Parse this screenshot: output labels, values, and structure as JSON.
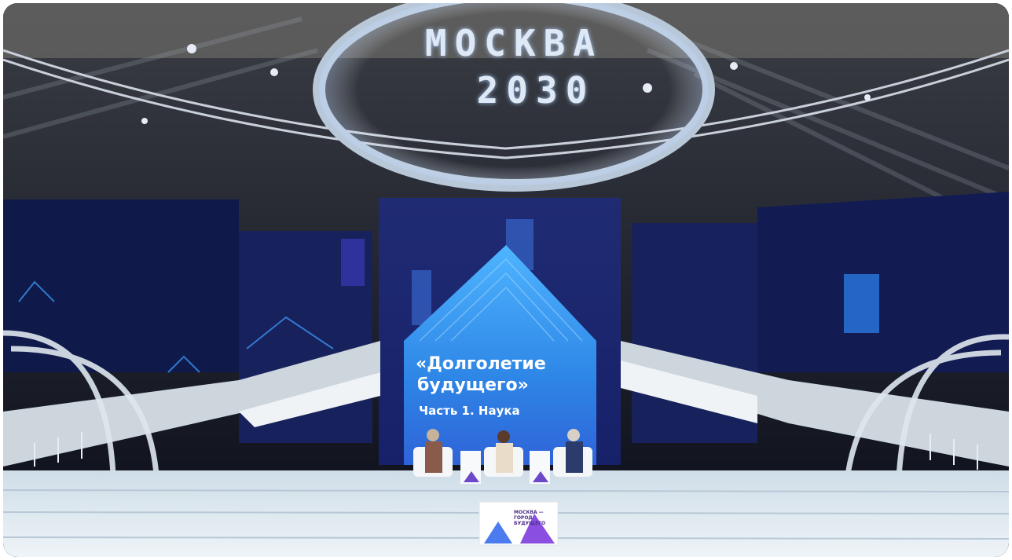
{
  "ceiling_sign": {
    "line1": "MOCKBA",
    "line2": "2030"
  },
  "screen": {
    "title_line1": "«Долголетие",
    "title_line2": "будущего»",
    "subtitle": "Часть 1. Наука"
  },
  "lectern": {
    "text": "МОСКВА — ГОРОД БУДУЩЕГО"
  },
  "colors": {
    "screen_blue": "#2f8fe8",
    "backdrop_navy": "#141d55",
    "accent_purple": "#7b3fd0",
    "stage_white": "#d9e6ef"
  }
}
